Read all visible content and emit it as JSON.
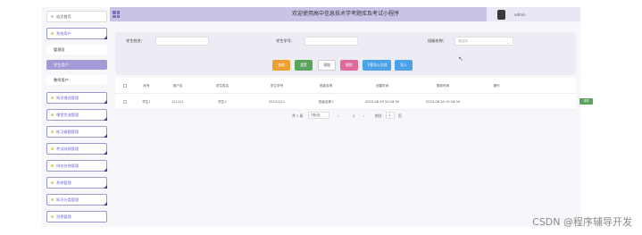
{
  "header": {
    "title": "欢迎使用高中信息技术学考题库及考试小程序",
    "username": "admin"
  },
  "sidebar": {
    "items": [
      {
        "label": "站点首页"
      },
      {
        "label": "系统用户"
      },
      {
        "label": "管理员"
      },
      {
        "label": "学生用户"
      },
      {
        "label": "教师用户"
      },
      {
        "label": "知识描述管理"
      },
      {
        "label": "课堂交流管理"
      },
      {
        "label": "练习做题管理"
      },
      {
        "label": "考试成绩管理"
      },
      {
        "label": "排名名称管理"
      },
      {
        "label": "系统管理"
      },
      {
        "label": "知识分类管理"
      },
      {
        "label": "消息管理"
      }
    ]
  },
  "search": {
    "name_label": "学生姓名：",
    "id_label": "学生学号：",
    "grade_label": "班级名称：",
    "grade_placeholder": "请选择"
  },
  "toolbar": {
    "search": "查询",
    "reset": "重置",
    "add": "添加",
    "delete": "删除",
    "template": "下载导入文档",
    "import": "导入"
  },
  "table": {
    "headers": [
      "序号",
      "用户名",
      "学生姓名",
      "学生学号",
      "班级名称",
      "创建时间",
      "更新时间",
      "操作"
    ],
    "rows": [
      [
        "学生1",
        "111111",
        "学生1",
        "20221111",
        "班级名称1",
        "2023-08-29 10:18:34",
        "2023-08-29 10:18:34",
        "详情"
      ]
    ]
  },
  "pagination": {
    "total": "共 1 条",
    "page_size": "7条/页",
    "current": "1",
    "goto_label": "前往",
    "goto_value": "1",
    "page_suffix": "页"
  },
  "watermark": "CSDN @程序辅导开发",
  "colors": {
    "accent": "#c9c4e6",
    "active": "#a39ad6",
    "search_btn": "#f0a030",
    "reset_btn": "#5aa35a",
    "delete_btn": "#e06b9b",
    "template_btn": "#4aa3e8",
    "import_btn": "#4aa3e8"
  }
}
